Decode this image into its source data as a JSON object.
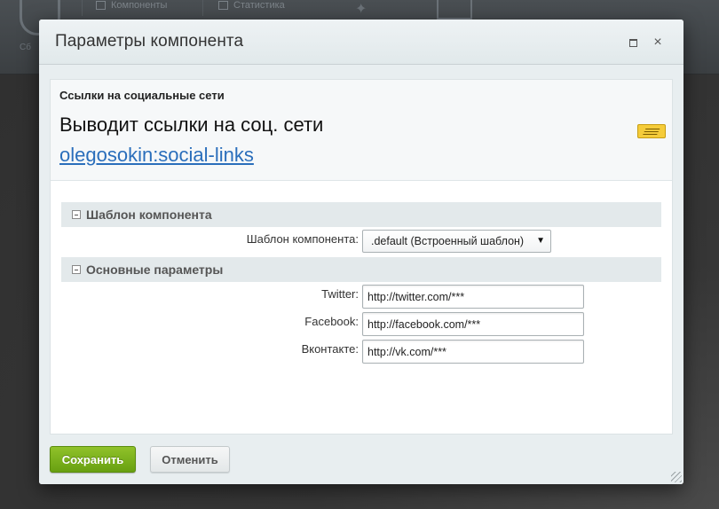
{
  "background": {
    "menu_items": [
      "Компоненты",
      "Статистика"
    ],
    "left_label": "Сб"
  },
  "dialog": {
    "title": "Параметры компонента",
    "maximize_icon": "maximize-icon",
    "close_icon": "close-icon",
    "close_symbol": "×"
  },
  "component": {
    "heading": "Ссылки на социальные сети",
    "description": "Выводит ссылки на соц. сети",
    "code": "olegosokin:social-links",
    "doc_icon": "document-icon"
  },
  "sections": [
    {
      "title": "Шаблон компонента",
      "fields": [
        {
          "label": "Шаблон компонента:",
          "type": "select",
          "value": ".default (Встроенный шаблон)"
        }
      ]
    },
    {
      "title": "Основные параметры",
      "fields": [
        {
          "label": "Twitter:",
          "type": "text",
          "value": "http://twitter.com/***"
        },
        {
          "label": "Facebook:",
          "type": "text",
          "value": "http://facebook.com/***"
        },
        {
          "label": "Вконтакте:",
          "type": "text",
          "value": "http://vk.com/***"
        }
      ]
    }
  ],
  "footer": {
    "save_label": "Сохранить",
    "cancel_label": "Отменить"
  },
  "colors": {
    "save_button": "#7bb21c",
    "link": "#2a6ebb",
    "header_bg": "#e6ecee"
  }
}
